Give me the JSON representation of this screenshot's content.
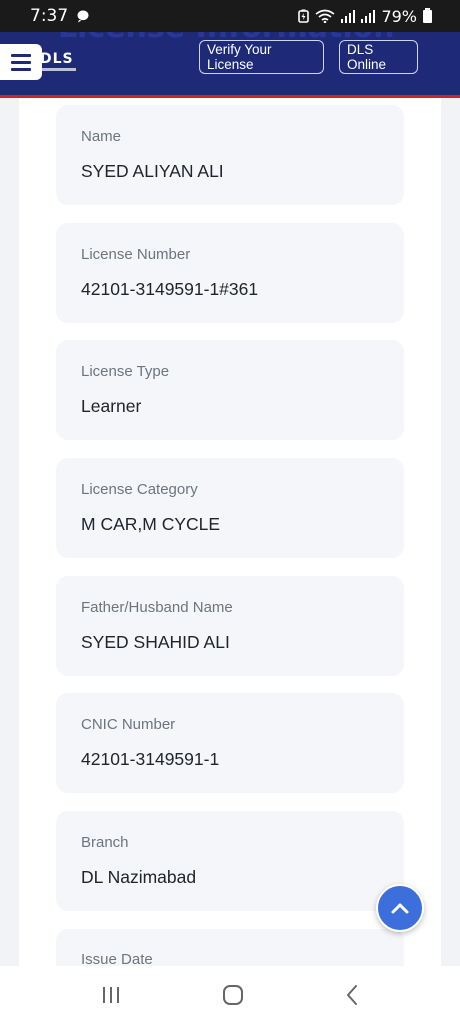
{
  "status_bar": {
    "time": "7:37",
    "battery_percent": "79%"
  },
  "header": {
    "background_title": "License Information",
    "logo_text": "DLS",
    "verify_button_label": "Verify Your License",
    "dls_online_button_label": "DLS Online"
  },
  "fields": [
    {
      "label": "Name",
      "value": "SYED ALIYAN ALI"
    },
    {
      "label": "License Number",
      "value": "42101-3149591-1#361"
    },
    {
      "label": "License Type",
      "value": "Learner"
    },
    {
      "label": "License Category",
      "value": "M CAR,M CYCLE"
    },
    {
      "label": "Father/Husband Name",
      "value": "SYED SHAHID ALI"
    },
    {
      "label": "CNIC Number",
      "value": "42101-3149591-1"
    },
    {
      "label": "Branch",
      "value": "DL Nazimabad"
    },
    {
      "label": "Issue Date",
      "value": ""
    }
  ],
  "colors": {
    "header_bg": "#1e2a78",
    "header_border": "#c62828",
    "scroll_button": "#3d6fdc"
  },
  "icons": {
    "menu": "hamburger-icon",
    "scroll_top": "chevron-up-icon",
    "nav_recents": "recents-icon",
    "nav_home": "home-icon",
    "nav_back": "back-icon"
  }
}
